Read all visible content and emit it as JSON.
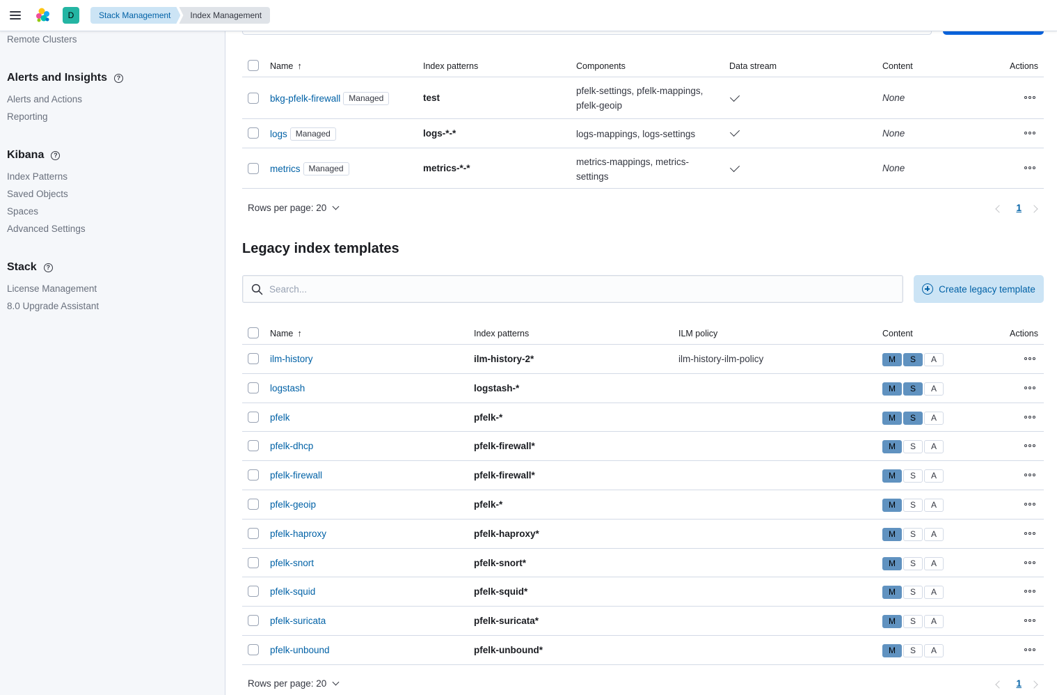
{
  "header": {
    "space_initial": "D",
    "breadcrumbs": [
      "Stack Management",
      "Index Management"
    ]
  },
  "sidebar": {
    "top_link": "Remote Clusters",
    "sections": [
      {
        "title": "Alerts and Insights",
        "items": [
          "Alerts and Actions",
          "Reporting"
        ]
      },
      {
        "title": "Kibana",
        "items": [
          "Index Patterns",
          "Saved Objects",
          "Spaces",
          "Advanced Settings"
        ]
      },
      {
        "title": "Stack",
        "items": [
          "License Management",
          "8.0 Upgrade Assistant"
        ]
      }
    ]
  },
  "composable": {
    "columns": [
      "Name",
      "Index patterns",
      "Components",
      "Data stream",
      "Content",
      "Actions"
    ],
    "rows": [
      {
        "name": "bkg-pfelk-firewall",
        "badge": "Managed",
        "pattern": "test",
        "components": [
          "pfelk-settings, pfelk-mappings,",
          "pfelk-geoip"
        ],
        "content": "None"
      },
      {
        "name": "logs",
        "badge": "Managed",
        "pattern": "logs-*-*",
        "components": [
          "logs-mappings, logs-settings"
        ],
        "content": "None"
      },
      {
        "name": "metrics",
        "badge": "Managed",
        "pattern": "metrics-*-*",
        "components": [
          "metrics-mappings, metrics-",
          "settings"
        ],
        "content": "None"
      }
    ],
    "rows_per_page": "Rows per page: 20",
    "page": "1"
  },
  "legacy": {
    "title": "Legacy index templates",
    "search_placeholder": "Search...",
    "create_button": "Create legacy template",
    "columns": [
      "Name",
      "Index patterns",
      "ILM policy",
      "Content",
      "Actions"
    ],
    "content_letters": [
      "M",
      "S",
      "A"
    ],
    "rows": [
      {
        "name": "ilm-history",
        "pattern": "ilm-history-2*",
        "ilm": "ilm-history-ilm-policy",
        "m": true,
        "s": true,
        "a": false
      },
      {
        "name": "logstash",
        "pattern": "logstash-*",
        "ilm": "",
        "m": true,
        "s": true,
        "a": false
      },
      {
        "name": "pfelk",
        "pattern": "pfelk-*",
        "ilm": "",
        "m": true,
        "s": true,
        "a": false
      },
      {
        "name": "pfelk-dhcp",
        "pattern": "pfelk-firewall*",
        "ilm": "",
        "m": true,
        "s": false,
        "a": false
      },
      {
        "name": "pfelk-firewall",
        "pattern": "pfelk-firewall*",
        "ilm": "",
        "m": true,
        "s": false,
        "a": false
      },
      {
        "name": "pfelk-geoip",
        "pattern": "pfelk-*",
        "ilm": "",
        "m": true,
        "s": false,
        "a": false
      },
      {
        "name": "pfelk-haproxy",
        "pattern": "pfelk-haproxy*",
        "ilm": "",
        "m": true,
        "s": false,
        "a": false
      },
      {
        "name": "pfelk-snort",
        "pattern": "pfelk-snort*",
        "ilm": "",
        "m": true,
        "s": false,
        "a": false
      },
      {
        "name": "pfelk-squid",
        "pattern": "pfelk-squid*",
        "ilm": "",
        "m": true,
        "s": false,
        "a": false
      },
      {
        "name": "pfelk-suricata",
        "pattern": "pfelk-suricata*",
        "ilm": "",
        "m": true,
        "s": false,
        "a": false
      },
      {
        "name": "pfelk-unbound",
        "pattern": "pfelk-unbound*",
        "ilm": "",
        "m": true,
        "s": false,
        "a": false
      }
    ],
    "rows_per_page": "Rows per page: 20",
    "page": "1"
  }
}
